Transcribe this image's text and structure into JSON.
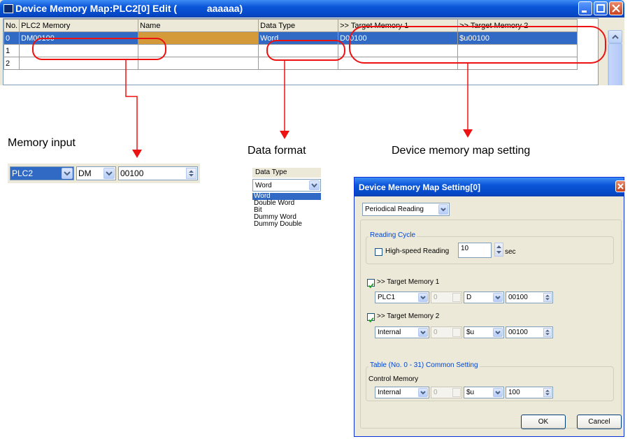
{
  "window": {
    "title": "Device Memory Map:PLC2[0] Edit (           aaaaaa)",
    "columns": [
      "No.",
      "PLC2 Memory",
      "Name",
      "Data Type",
      ">> Target Memory 1",
      ">> Target Memory 2"
    ],
    "rows": [
      [
        "0",
        "DM00100",
        "",
        "Word",
        "D00100",
        "$u00100"
      ],
      [
        "1",
        "",
        "",
        "",
        "",
        ""
      ],
      [
        "2",
        "",
        "",
        "",
        "",
        ""
      ]
    ],
    "selected_row": 0
  },
  "annotations": {
    "memory_input": "Memory input",
    "data_format": "Data format",
    "device_memory_map_setting": "Device memory map setting"
  },
  "memory_input": {
    "device": "PLC2",
    "memory_type": "DM",
    "address": "00100"
  },
  "data_type": {
    "header": "Data Type",
    "selected": "Word",
    "options": [
      "Word",
      "Double Word",
      "Bit",
      "Dummy Word",
      "Dummy Double"
    ]
  },
  "dialog": {
    "title": "Device Memory Map Setting[0]",
    "mode": "Periodical Reading",
    "reading_cycle": {
      "group_label": "Reading Cycle",
      "high_speed_label": "High-speed Reading",
      "high_speed_checked": false,
      "cycle_value": "10",
      "unit": "sec"
    },
    "target1": {
      "label": ">> Target Memory 1",
      "checked": true,
      "device": "PLC1",
      "station": "0",
      "memory_type": "D",
      "address": "00100"
    },
    "target2": {
      "label": ">> Target Memory 2",
      "checked": true,
      "device": "Internal",
      "station": "0",
      "memory_type": "$u",
      "address": "00100"
    },
    "common": {
      "group_label": "Table (No. 0 - 31) Common Setting",
      "control_memory_label": "Control Memory",
      "device": "Internal",
      "station": "0",
      "memory_type": "$u",
      "address": "100"
    },
    "ok_label": "OK",
    "cancel_label": "Cancel"
  },
  "colors": {
    "title_bar": "#0a55d8",
    "selection": "#316ac5",
    "highlight": "#ee1111",
    "name_cell": "#d49a3a"
  }
}
